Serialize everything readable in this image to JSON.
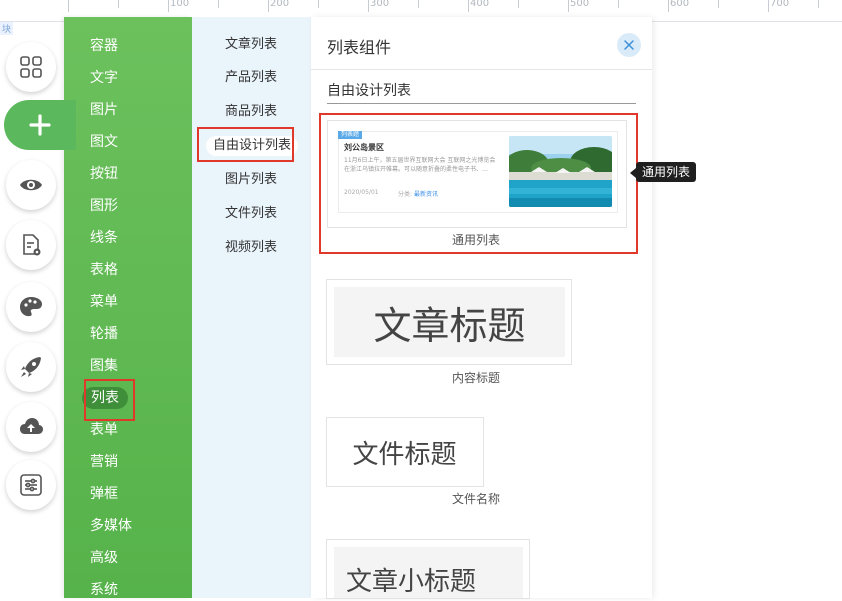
{
  "ruler": {
    "labels": [
      "100",
      "200",
      "300",
      "400",
      "500",
      "600",
      "700"
    ],
    "corner_tag": "块"
  },
  "toolbar": {
    "tools": [
      {
        "name": "grid-icon"
      },
      {
        "name": "plus-icon"
      },
      {
        "name": "eye-icon"
      },
      {
        "name": "document-settings-icon"
      },
      {
        "name": "palette-icon"
      },
      {
        "name": "rocket-icon"
      },
      {
        "name": "cloud-upload-icon"
      },
      {
        "name": "sliders-icon"
      }
    ]
  },
  "categories": [
    "容器",
    "文字",
    "图片",
    "图文",
    "按钮",
    "图形",
    "线条",
    "表格",
    "菜单",
    "轮播",
    "图集",
    "列表",
    "表单",
    "营销",
    "弹框",
    "多媒体",
    "高级",
    "系统"
  ],
  "selected_category": "列表",
  "subcategories": [
    "文章列表",
    "产品列表",
    "商品列表",
    "自由设计列表",
    "图片列表",
    "文件列表",
    "视频列表"
  ],
  "selected_subcategory": "自由设计列表",
  "panel": {
    "title": "列表组件",
    "section_title": "自由设计列表"
  },
  "templates": {
    "card": {
      "badge": "列表题",
      "title": "刘公岛景区",
      "desc": "11月6日上午，第五届世界互联网大会 互联网之光博览会在浙江乌镇拉开帷幕。可以随意折叠的柔性电子书、…",
      "date": "2020/05/01",
      "category_label": "分类:",
      "category_value": "最新资讯",
      "caption": "通用列表"
    },
    "title_big": {
      "text": "文章标题",
      "caption": "内容标题"
    },
    "file_title": {
      "text": "文件标题",
      "caption": "文件名称"
    },
    "small_title": {
      "text": "文章小标题"
    }
  },
  "tooltip": "通用列表",
  "colors": {
    "accent_green": "#5cb85c",
    "highlight_red": "#e0392b",
    "sub_bg": "#eaf4fb"
  }
}
